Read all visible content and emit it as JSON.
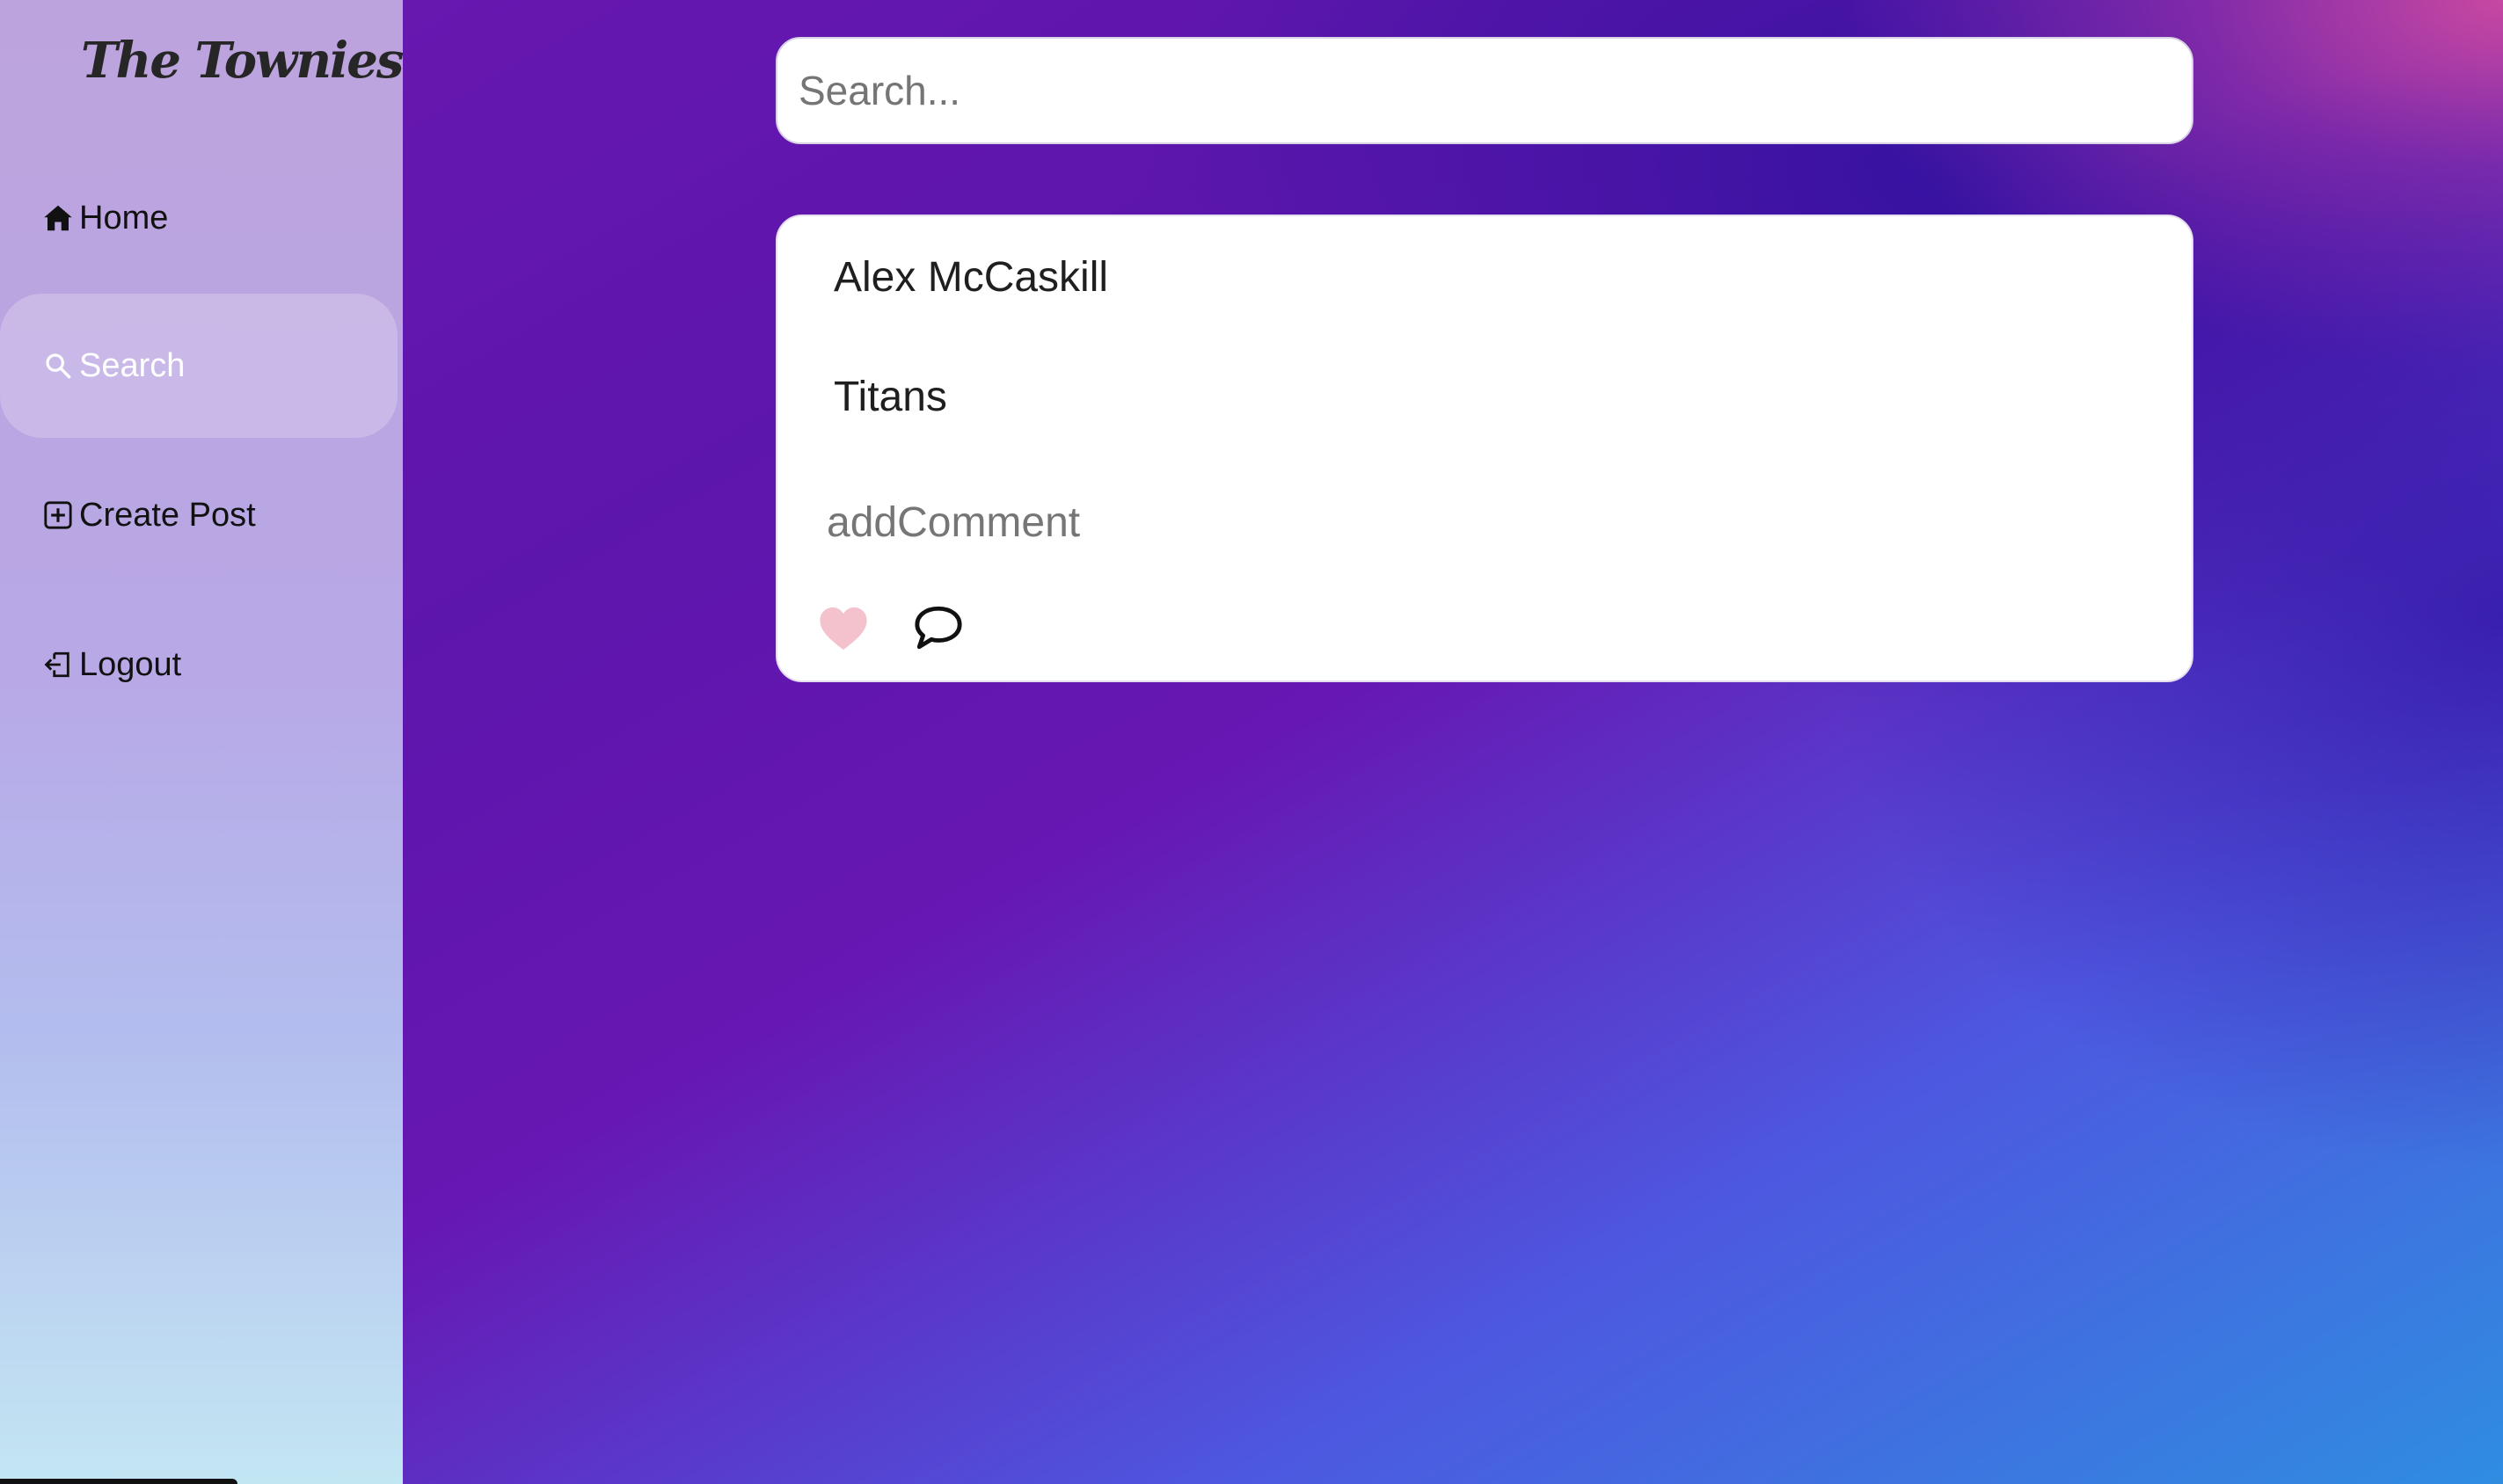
{
  "brand": {
    "logo_text": "The Townies"
  },
  "sidebar": {
    "items": [
      {
        "label": "Home",
        "icon": "home-icon",
        "active": false
      },
      {
        "label": "Search",
        "icon": "search-icon",
        "active": true
      },
      {
        "label": "Create Post",
        "icon": "plus-square-icon",
        "active": false
      },
      {
        "label": "Logout",
        "icon": "logout-icon",
        "active": false
      }
    ]
  },
  "search": {
    "placeholder": "Search...",
    "value": ""
  },
  "results": [
    {
      "author": "Alex McCaskill",
      "text": "Titans",
      "comment_placeholder": "addComment",
      "like_icon": "heart-icon",
      "comment_icon": "speech-bubble-icon"
    }
  ],
  "colors": {
    "like_heart": "#f4c2cc",
    "sidebar_top": "#bda3dd",
    "sidebar_bottom": "#c3e6f3",
    "background_purple": "#6a18b0",
    "background_blue": "#4d58e0",
    "active_nav_text": "#ffffff"
  }
}
